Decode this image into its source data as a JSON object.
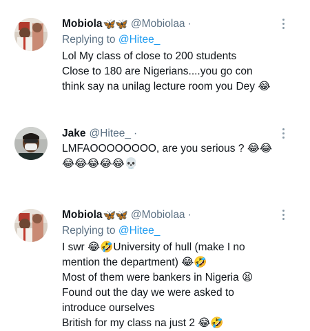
{
  "tweets": [
    {
      "name": "Mobiola",
      "badge": "🦋🦋",
      "handle": "@Mobiolaa",
      "dot": "·",
      "replying_prefix": "Replying to ",
      "replying_to": "@Hitee_",
      "lines": [
        "Lol My class of close to 200 students",
        "Close to 180 are Nigerians....you go con",
        "think say na unilag lecture room you Dey 😂"
      ]
    },
    {
      "name": "Jake",
      "handle": "@Hitee_",
      "dot": "·",
      "lines": [
        "LMFAOOOOOOOO, are you serious ? 😂😂",
        "😂😂😂😂😂💀"
      ]
    },
    {
      "name": "Mobiola",
      "badge": "🦋🦋",
      "handle": "@Mobiolaa",
      "dot": "·",
      "replying_prefix": "Replying to ",
      "replying_to": "@Hitee_",
      "lines": [
        "I swr 😂🤣University of hull (make I no",
        "mention the department) 😂🤣",
        "Most of them were bankers in Nigeria 😫",
        "Found out the day we were asked to",
        "introduce ourselves",
        "British for my class na just 2 😂🤣"
      ]
    }
  ],
  "icons": {
    "avatar_mobiola": "avatar-photo",
    "avatar_jake": "avatar-photo",
    "more": "more-vertical-icon"
  }
}
